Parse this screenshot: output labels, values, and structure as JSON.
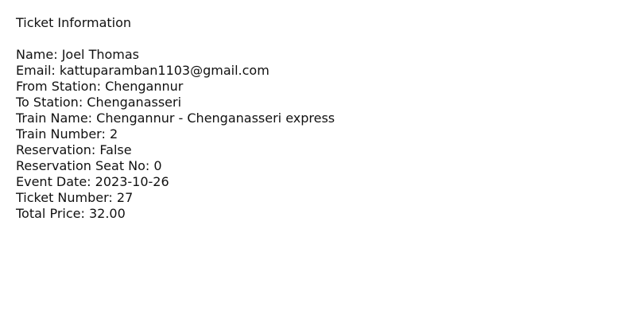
{
  "title": "Ticket Information",
  "fields": [
    {
      "label": "Name:",
      "value": "Joel Thomas"
    },
    {
      "label": "Email:",
      "value": "kattuparamban1103@gmail.com"
    },
    {
      "label": "From Station:",
      "value": "Chengannur"
    },
    {
      "label": "To Station:",
      "value": "Chenganasseri"
    },
    {
      "label": "Train Name:",
      "value": "Chengannur - Chenganasseri express"
    },
    {
      "label": "Train Number:",
      "value": "2"
    },
    {
      "label": "Reservation:",
      "value": "False"
    },
    {
      "label": "Reservation Seat No:",
      "value": "0"
    },
    {
      "label": "Event Date:",
      "value": "2023-10-26"
    },
    {
      "label": "Ticket Number:",
      "value": "27"
    },
    {
      "label": "Total Price:",
      "value": "32.00"
    }
  ]
}
